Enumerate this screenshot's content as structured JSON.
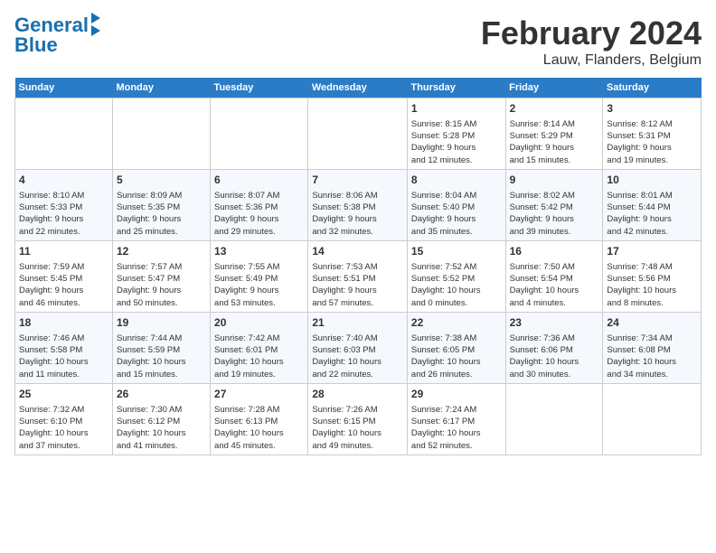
{
  "logo": {
    "line1": "General",
    "line2": "Blue"
  },
  "title": "February 2024",
  "subtitle": "Lauw, Flanders, Belgium",
  "days_header": [
    "Sunday",
    "Monday",
    "Tuesday",
    "Wednesday",
    "Thursday",
    "Friday",
    "Saturday"
  ],
  "weeks": [
    [
      {
        "num": "",
        "info": ""
      },
      {
        "num": "",
        "info": ""
      },
      {
        "num": "",
        "info": ""
      },
      {
        "num": "",
        "info": ""
      },
      {
        "num": "1",
        "info": "Sunrise: 8:15 AM\nSunset: 5:28 PM\nDaylight: 9 hours\nand 12 minutes."
      },
      {
        "num": "2",
        "info": "Sunrise: 8:14 AM\nSunset: 5:29 PM\nDaylight: 9 hours\nand 15 minutes."
      },
      {
        "num": "3",
        "info": "Sunrise: 8:12 AM\nSunset: 5:31 PM\nDaylight: 9 hours\nand 19 minutes."
      }
    ],
    [
      {
        "num": "4",
        "info": "Sunrise: 8:10 AM\nSunset: 5:33 PM\nDaylight: 9 hours\nand 22 minutes."
      },
      {
        "num": "5",
        "info": "Sunrise: 8:09 AM\nSunset: 5:35 PM\nDaylight: 9 hours\nand 25 minutes."
      },
      {
        "num": "6",
        "info": "Sunrise: 8:07 AM\nSunset: 5:36 PM\nDaylight: 9 hours\nand 29 minutes."
      },
      {
        "num": "7",
        "info": "Sunrise: 8:06 AM\nSunset: 5:38 PM\nDaylight: 9 hours\nand 32 minutes."
      },
      {
        "num": "8",
        "info": "Sunrise: 8:04 AM\nSunset: 5:40 PM\nDaylight: 9 hours\nand 35 minutes."
      },
      {
        "num": "9",
        "info": "Sunrise: 8:02 AM\nSunset: 5:42 PM\nDaylight: 9 hours\nand 39 minutes."
      },
      {
        "num": "10",
        "info": "Sunrise: 8:01 AM\nSunset: 5:44 PM\nDaylight: 9 hours\nand 42 minutes."
      }
    ],
    [
      {
        "num": "11",
        "info": "Sunrise: 7:59 AM\nSunset: 5:45 PM\nDaylight: 9 hours\nand 46 minutes."
      },
      {
        "num": "12",
        "info": "Sunrise: 7:57 AM\nSunset: 5:47 PM\nDaylight: 9 hours\nand 50 minutes."
      },
      {
        "num": "13",
        "info": "Sunrise: 7:55 AM\nSunset: 5:49 PM\nDaylight: 9 hours\nand 53 minutes."
      },
      {
        "num": "14",
        "info": "Sunrise: 7:53 AM\nSunset: 5:51 PM\nDaylight: 9 hours\nand 57 minutes."
      },
      {
        "num": "15",
        "info": "Sunrise: 7:52 AM\nSunset: 5:52 PM\nDaylight: 10 hours\nand 0 minutes."
      },
      {
        "num": "16",
        "info": "Sunrise: 7:50 AM\nSunset: 5:54 PM\nDaylight: 10 hours\nand 4 minutes."
      },
      {
        "num": "17",
        "info": "Sunrise: 7:48 AM\nSunset: 5:56 PM\nDaylight: 10 hours\nand 8 minutes."
      }
    ],
    [
      {
        "num": "18",
        "info": "Sunrise: 7:46 AM\nSunset: 5:58 PM\nDaylight: 10 hours\nand 11 minutes."
      },
      {
        "num": "19",
        "info": "Sunrise: 7:44 AM\nSunset: 5:59 PM\nDaylight: 10 hours\nand 15 minutes."
      },
      {
        "num": "20",
        "info": "Sunrise: 7:42 AM\nSunset: 6:01 PM\nDaylight: 10 hours\nand 19 minutes."
      },
      {
        "num": "21",
        "info": "Sunrise: 7:40 AM\nSunset: 6:03 PM\nDaylight: 10 hours\nand 22 minutes."
      },
      {
        "num": "22",
        "info": "Sunrise: 7:38 AM\nSunset: 6:05 PM\nDaylight: 10 hours\nand 26 minutes."
      },
      {
        "num": "23",
        "info": "Sunrise: 7:36 AM\nSunset: 6:06 PM\nDaylight: 10 hours\nand 30 minutes."
      },
      {
        "num": "24",
        "info": "Sunrise: 7:34 AM\nSunset: 6:08 PM\nDaylight: 10 hours\nand 34 minutes."
      }
    ],
    [
      {
        "num": "25",
        "info": "Sunrise: 7:32 AM\nSunset: 6:10 PM\nDaylight: 10 hours\nand 37 minutes."
      },
      {
        "num": "26",
        "info": "Sunrise: 7:30 AM\nSunset: 6:12 PM\nDaylight: 10 hours\nand 41 minutes."
      },
      {
        "num": "27",
        "info": "Sunrise: 7:28 AM\nSunset: 6:13 PM\nDaylight: 10 hours\nand 45 minutes."
      },
      {
        "num": "28",
        "info": "Sunrise: 7:26 AM\nSunset: 6:15 PM\nDaylight: 10 hours\nand 49 minutes."
      },
      {
        "num": "29",
        "info": "Sunrise: 7:24 AM\nSunset: 6:17 PM\nDaylight: 10 hours\nand 52 minutes."
      },
      {
        "num": "",
        "info": ""
      },
      {
        "num": "",
        "info": ""
      }
    ]
  ]
}
